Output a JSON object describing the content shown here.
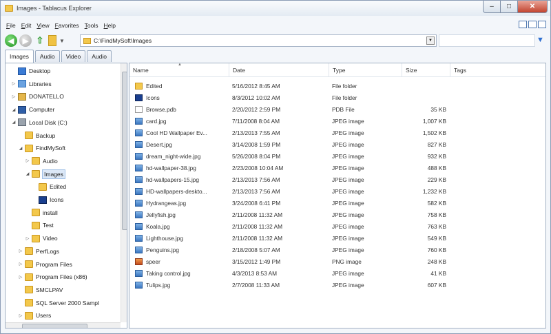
{
  "window": {
    "title": "Images - Tablacus Explorer",
    "min_glyph": "–",
    "max_glyph": "□",
    "close_glyph": "✕"
  },
  "menu": [
    {
      "u": "F",
      "rest": "ile"
    },
    {
      "u": "E",
      "rest": "dit"
    },
    {
      "u": "V",
      "rest": "iew"
    },
    {
      "u": "F",
      "rest": "avorites",
      "prefix": ""
    },
    {
      "u": "T",
      "rest": "ools"
    },
    {
      "u": "H",
      "rest": "elp"
    }
  ],
  "toolbar": {
    "back_glyph": "◀",
    "forward_glyph": "▶",
    "up_glyph": "⇧",
    "address": "C:\\FindMySoft\\Images",
    "dropdown_glyph": "▼",
    "filter_glyph": "▼"
  },
  "tabs": [
    {
      "label": "Images",
      "active": true
    },
    {
      "label": "Audio",
      "active": false
    },
    {
      "label": "Video",
      "active": false
    },
    {
      "label": "Audio",
      "active": false
    }
  ],
  "tree": [
    {
      "label": "Desktop",
      "icon": "desktop",
      "level": 0,
      "twisty": ""
    },
    {
      "label": "Libraries",
      "icon": "libraries",
      "level": 1,
      "twisty": "▷"
    },
    {
      "label": "DONATELLO",
      "icon": "network",
      "level": 1,
      "twisty": "▷"
    },
    {
      "label": "Computer",
      "icon": "computer",
      "level": 1,
      "twisty": "◢"
    },
    {
      "label": "Local Disk (C:)",
      "icon": "drive",
      "level": 2,
      "twisty": "◢"
    },
    {
      "label": "Backup",
      "icon": "folder",
      "level": 3,
      "twisty": ""
    },
    {
      "label": "FindMySoft",
      "icon": "folder",
      "level": 3,
      "twisty": "◢"
    },
    {
      "label": "Audio",
      "icon": "folder",
      "level": 4,
      "twisty": "▷"
    },
    {
      "label": "Images",
      "icon": "folder",
      "level": 4,
      "twisty": "◢",
      "selected": true
    },
    {
      "label": "Edited",
      "icon": "folder",
      "level": 5,
      "twisty": ""
    },
    {
      "label": "Icons",
      "icon": "icofile",
      "level": 5,
      "twisty": ""
    },
    {
      "label": "install",
      "icon": "folder",
      "level": 4,
      "twisty": ""
    },
    {
      "label": "Test",
      "icon": "folder",
      "level": 4,
      "twisty": ""
    },
    {
      "label": "Video",
      "icon": "folder",
      "level": 4,
      "twisty": "▷"
    },
    {
      "label": "PerfLogs",
      "icon": "folder",
      "level": 3,
      "twisty": "▷"
    },
    {
      "label": "Program Files",
      "icon": "folder",
      "level": 3,
      "twisty": "▷"
    },
    {
      "label": "Program Files (x86)",
      "icon": "folder",
      "level": 3,
      "twisty": "▷"
    },
    {
      "label": "SMCLPAV",
      "icon": "folder",
      "level": 3,
      "twisty": ""
    },
    {
      "label": "SQL Server 2000 Sampl",
      "icon": "folder",
      "level": 3,
      "twisty": ""
    },
    {
      "label": "Users",
      "icon": "folder",
      "level": 3,
      "twisty": "▷"
    }
  ],
  "columns": {
    "name": "Name",
    "date": "Date",
    "type": "Type",
    "size": "Size",
    "tags": "Tags",
    "sort_glyph": "▲"
  },
  "files": [
    {
      "name": "Edited",
      "icon": "folder",
      "date": "5/16/2012 8:45 AM",
      "type": "File folder",
      "size": ""
    },
    {
      "name": "Icons",
      "icon": "icofile",
      "date": "8/3/2012 10:02 AM",
      "type": "File folder",
      "size": ""
    },
    {
      "name": "Browse.pdb",
      "icon": "pdb",
      "date": "2/20/2012 2:59 PM",
      "type": "PDB File",
      "size": "35 KB"
    },
    {
      "name": "card.jpg",
      "icon": "jpeg",
      "date": "7/11/2008 8:04 AM",
      "type": "JPEG image",
      "size": "1,007 KB"
    },
    {
      "name": "Cool HD Wallpaper Ev...",
      "icon": "jpeg",
      "date": "2/13/2013 7:55 AM",
      "type": "JPEG image",
      "size": "1,502 KB"
    },
    {
      "name": "Desert.jpg",
      "icon": "jpeg",
      "date": "3/14/2008 1:59 PM",
      "type": "JPEG image",
      "size": "827 KB"
    },
    {
      "name": "dream_night-wide.jpg",
      "icon": "jpeg",
      "date": "5/26/2008 8:04 PM",
      "type": "JPEG image",
      "size": "932 KB"
    },
    {
      "name": "hd-wallpaper-38.jpg",
      "icon": "jpeg",
      "date": "2/23/2008 10:04 AM",
      "type": "JPEG image",
      "size": "488 KB"
    },
    {
      "name": "hd-wallpapers-15.jpg",
      "icon": "jpeg",
      "date": "2/13/2013 7:56 AM",
      "type": "JPEG image",
      "size": "229 KB"
    },
    {
      "name": "HD-wallpapers-deskto...",
      "icon": "jpeg",
      "date": "2/13/2013 7:56 AM",
      "type": "JPEG image",
      "size": "1,232 KB"
    },
    {
      "name": "Hydrangeas.jpg",
      "icon": "jpeg",
      "date": "3/24/2008 6:41 PM",
      "type": "JPEG image",
      "size": "582 KB"
    },
    {
      "name": "Jellyfish.jpg",
      "icon": "jpeg",
      "date": "2/11/2008 11:32 AM",
      "type": "JPEG image",
      "size": "758 KB"
    },
    {
      "name": "Koala.jpg",
      "icon": "jpeg",
      "date": "2/11/2008 11:32 AM",
      "type": "JPEG image",
      "size": "763 KB"
    },
    {
      "name": "Lighthouse.jpg",
      "icon": "jpeg",
      "date": "2/11/2008 11:32 AM",
      "type": "JPEG image",
      "size": "549 KB"
    },
    {
      "name": "Penguins.jpg",
      "icon": "jpeg",
      "date": "2/18/2008 5:07 AM",
      "type": "JPEG image",
      "size": "760 KB"
    },
    {
      "name": "speer",
      "icon": "png",
      "date": "3/15/2012 1:49 PM",
      "type": "PNG image",
      "size": "248 KB"
    },
    {
      "name": "Taking control.jpg",
      "icon": "jpeg",
      "date": "4/3/2013 8:53 AM",
      "type": "JPEG image",
      "size": "41 KB"
    },
    {
      "name": "Tulips.jpg",
      "icon": "jpeg",
      "date": "2/7/2008 11:33 AM",
      "type": "JPEG image",
      "size": "607 KB"
    }
  ]
}
